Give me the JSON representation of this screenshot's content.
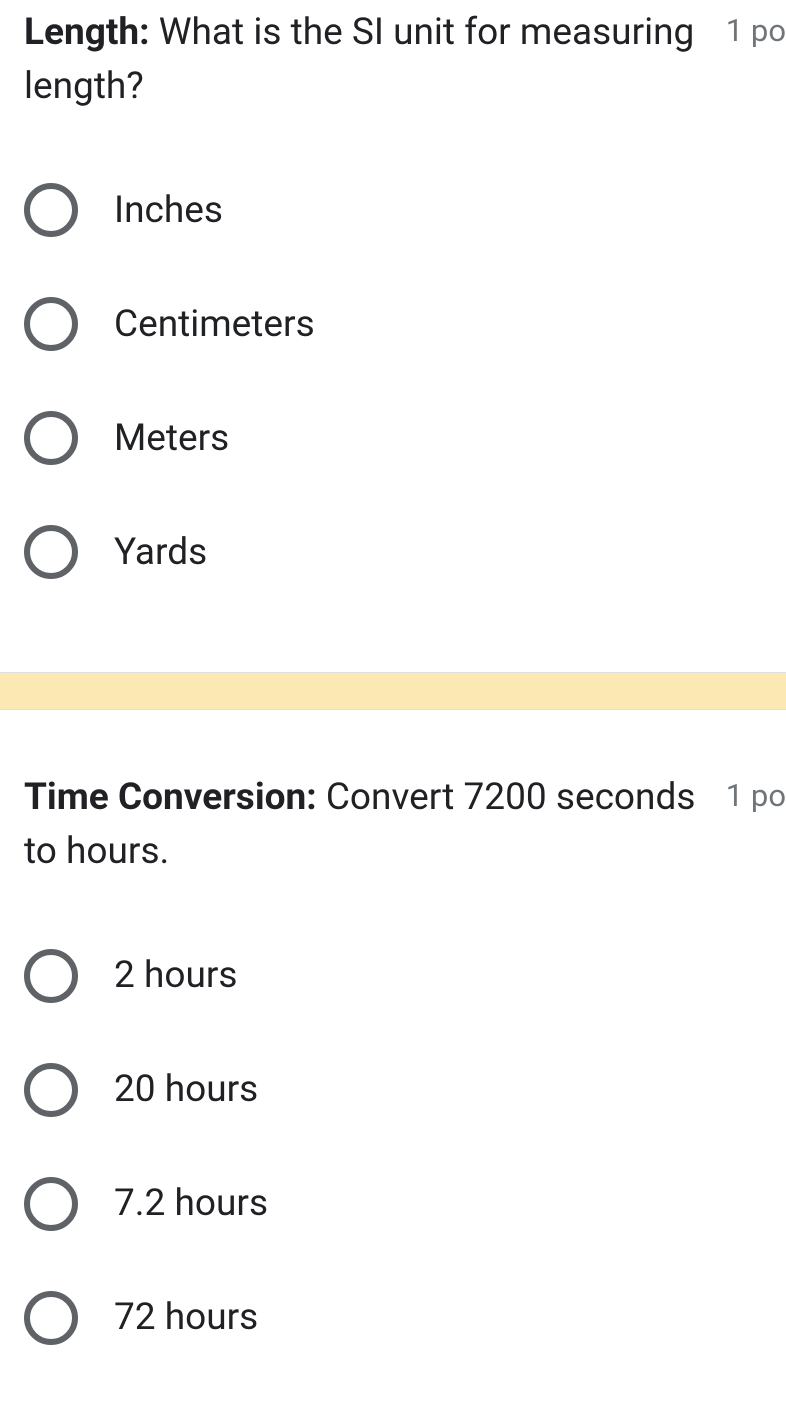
{
  "questions": [
    {
      "prefix": "Length:",
      "text": " What is the SI unit for measuring length?",
      "points": "1 po",
      "options": [
        {
          "label": "Inches"
        },
        {
          "label": "Centimeters"
        },
        {
          "label": "Meters"
        },
        {
          "label": "Yards"
        }
      ]
    },
    {
      "prefix": "Time Conversion:",
      "text": " Convert 7200 seconds to hours.",
      "points": "1 po",
      "options": [
        {
          "label": "2 hours"
        },
        {
          "label": "20 hours"
        },
        {
          "label": "7.2 hours"
        },
        {
          "label": "72 hours"
        }
      ]
    }
  ]
}
